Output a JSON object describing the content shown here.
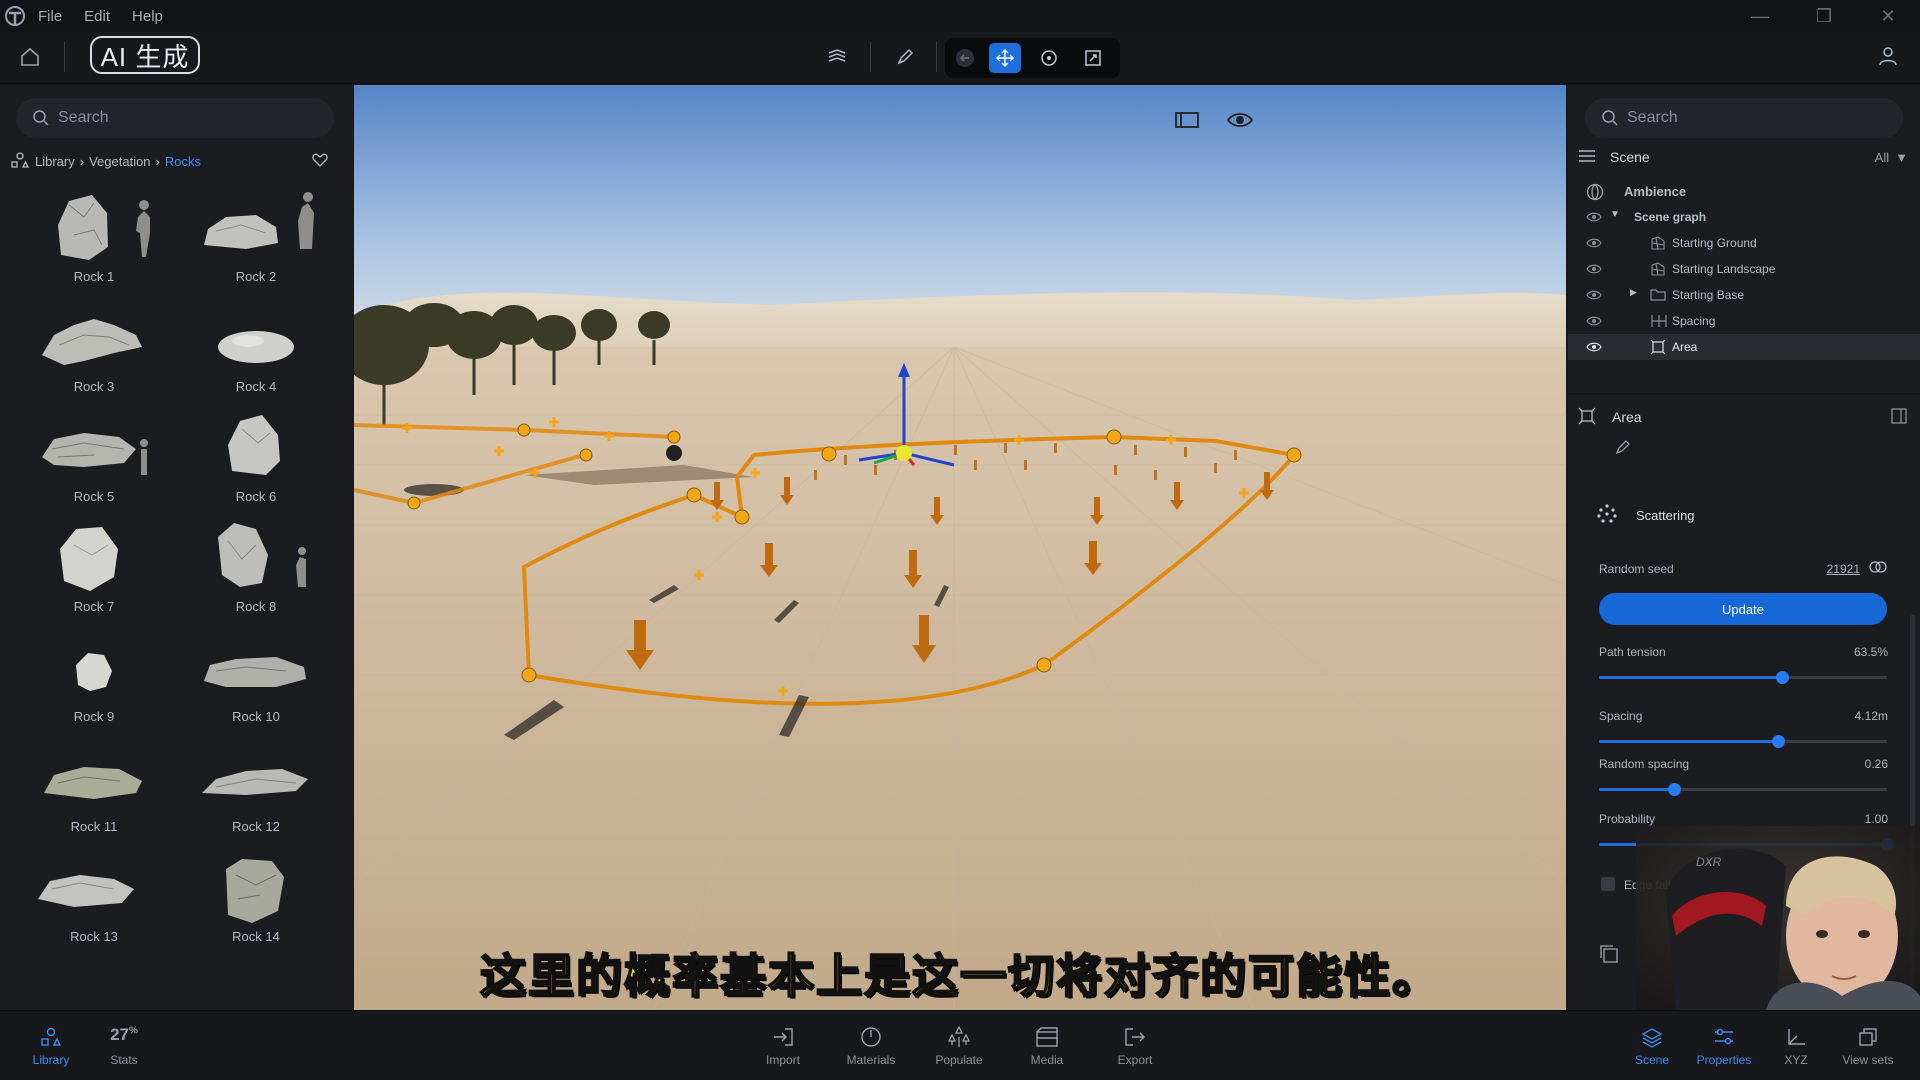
{
  "menu": {
    "items": [
      "File",
      "Edit",
      "Help"
    ]
  },
  "toolbar": {
    "ai_label": "AI 生成"
  },
  "left": {
    "search_placeholder": "Search",
    "breadcrumb": {
      "root": "Library",
      "mid": "Vegetation",
      "current": "Rocks"
    },
    "assets": [
      "Rock 1",
      "Rock 2",
      "Rock 3",
      "Rock 4",
      "Rock 5",
      "Rock 6",
      "Rock 7",
      "Rock 8",
      "Rock 9",
      "Rock 10",
      "Rock 11",
      "Rock 12",
      "Rock 13",
      "Rock 14"
    ]
  },
  "viewport": {
    "subtitle": "这里的概率基本上是这一切将对齐的可能性。"
  },
  "right": {
    "search_placeholder": "Search",
    "scene_title": "Scene",
    "filter": "All",
    "tree": {
      "ambience": "Ambience",
      "scene_graph": "Scene graph",
      "starting_ground": "Starting Ground",
      "starting_landscape": "Starting Landscape",
      "starting_base": "Starting Base",
      "spacing": "Spacing",
      "area": "Area"
    },
    "area_title": "Area",
    "scattering": "Scattering",
    "random_seed_label": "Random seed",
    "random_seed_value": "21921",
    "update_label": "Update",
    "path_tension": {
      "label": "Path tension",
      "value": "63.5%",
      "fraction": 0.635
    },
    "spacing": {
      "label": "Spacing",
      "value": "4.12m",
      "fraction": 0.62
    },
    "random_spacing": {
      "label": "Random spacing",
      "value": "0.26",
      "fraction": 0.26
    },
    "probability": {
      "label": "Probability",
      "value": "1.00",
      "fraction": 1.0
    },
    "edge_falloff": "Edge falloff"
  },
  "bottom": {
    "library": "Library",
    "stats_value": "27",
    "stats_unit": "%",
    "stats": "Stats",
    "import": "Import",
    "materials": "Materials",
    "populate": "Populate",
    "media": "Media",
    "export": "Export",
    "scene": "Scene",
    "properties": "Properties",
    "xyz": "XYZ",
    "view_sets": "View sets"
  },
  "colors": {
    "accent": "#1f6fdc",
    "path": "#e08a12",
    "subtitle": "#f3d418"
  }
}
